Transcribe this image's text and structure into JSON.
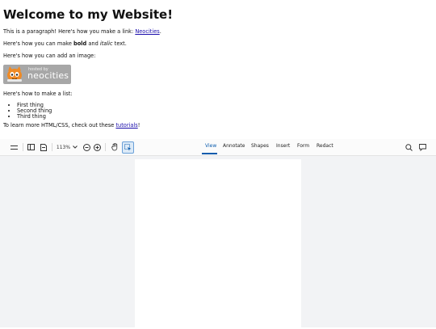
{
  "page": {
    "heading": "Welcome to my Website!",
    "para1_text": "This is a paragraph! Here's how you make a link: ",
    "para1_link": "Neocities",
    "para1_end": ".",
    "para2_a": "Here's how you can make ",
    "para2_bold": "bold",
    "para2_b": " and ",
    "para2_italic": "italic",
    "para2_c": " text.",
    "para3": "Here's how you can add an image:",
    "badge_hosted": "hosted by",
    "badge_brand": "neocities",
    "para4": "Here's how to make a list:",
    "list": [
      "First thing",
      "Second thing",
      "Third thing"
    ],
    "para5_text": "To learn more HTML/CSS, check out these ",
    "para5_link": "tutorials",
    "para5_end": "!"
  },
  "toolbar": {
    "zoom_label": "113%",
    "tabs": [
      "View",
      "Annotate",
      "Shapes",
      "Insert",
      "Form",
      "Redact"
    ],
    "selected_tab": "View"
  },
  "colors": {
    "accent": "#0b5cad",
    "viewer_background": "#f2f3f5",
    "link": "#1a0dab"
  }
}
